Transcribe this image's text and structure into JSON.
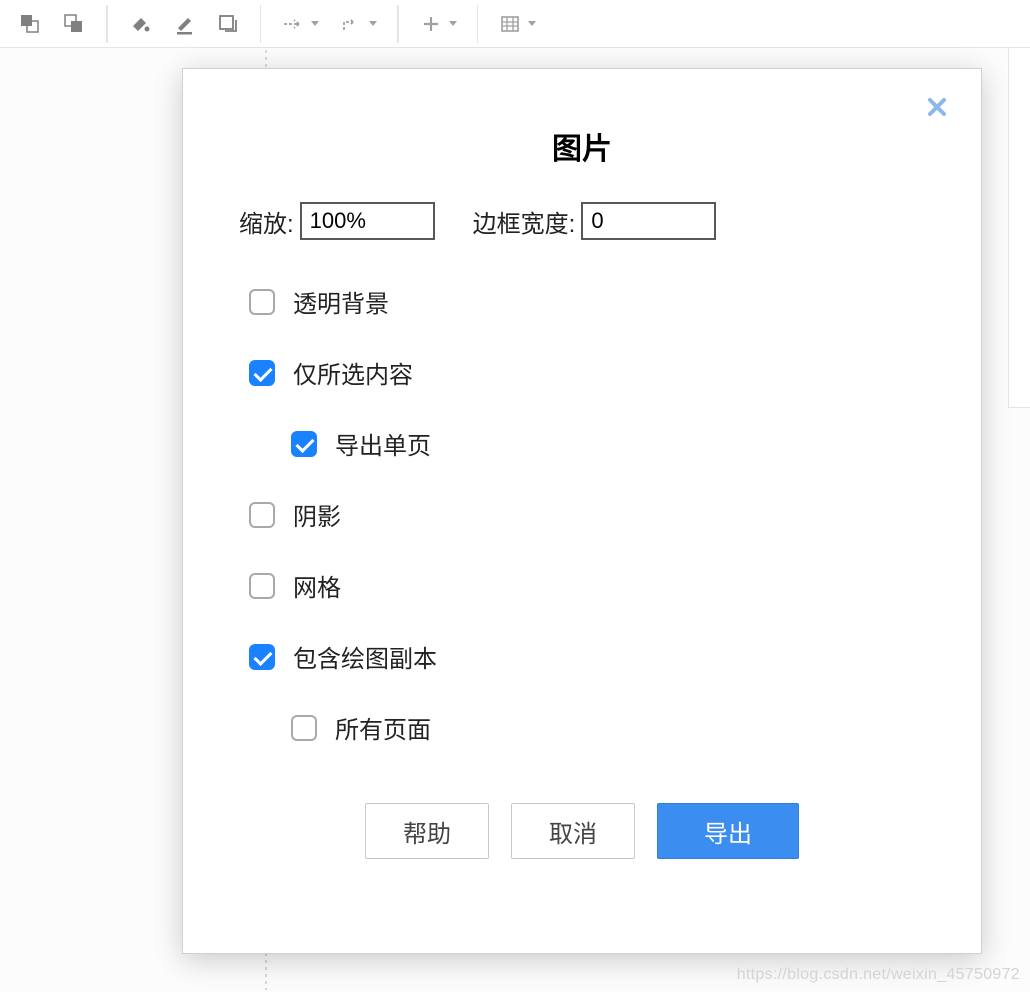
{
  "toolbar": {
    "icons": [
      "to-front-icon",
      "to-back-icon",
      "fill-color-icon",
      "line-color-icon",
      "shadow-icon",
      "connection-style-icon",
      "waypoint-icon",
      "add-icon",
      "table-icon"
    ]
  },
  "dialog": {
    "title": "图片",
    "zoom": {
      "label": "缩放:",
      "value": "100%"
    },
    "border": {
      "label": "边框宽度:",
      "value": "0"
    },
    "options": {
      "transparent": {
        "label": "透明背景",
        "checked": false
      },
      "selection": {
        "label": "仅所选内容",
        "checked": true
      },
      "single_page": {
        "label": "导出单页",
        "checked": true
      },
      "shadow": {
        "label": "阴影",
        "checked": false
      },
      "grid": {
        "label": "网格",
        "checked": false
      },
      "include_copy": {
        "label": "包含绘图副本",
        "checked": true
      },
      "all_pages": {
        "label": "所有页面",
        "checked": false
      }
    },
    "buttons": {
      "help": "帮助",
      "cancel": "取消",
      "export": "导出"
    }
  },
  "watermark": "https://blog.csdn.net/weixin_45750972"
}
